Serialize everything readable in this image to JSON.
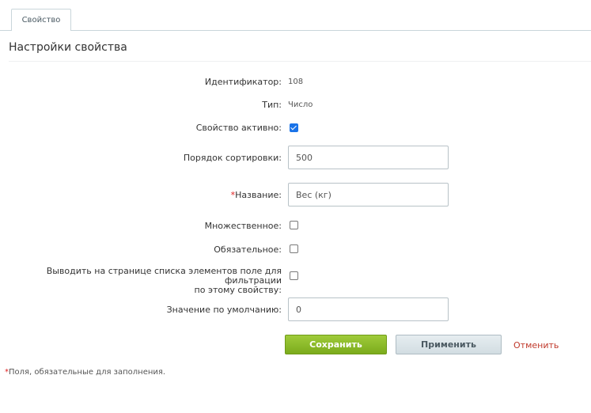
{
  "tabs": [
    {
      "label": "Свойство"
    }
  ],
  "section": {
    "title": "Настройки свойства"
  },
  "fields": {
    "id": {
      "label": "Идентификатор:",
      "value": "108"
    },
    "type": {
      "label": "Тип:",
      "value": "Число"
    },
    "active": {
      "label": "Свойство активно:",
      "checked": true
    },
    "sort": {
      "label": "Порядок сортировки:",
      "value": "500"
    },
    "name": {
      "required_mark": "*",
      "label": "Название:",
      "value": "Вес (кг)"
    },
    "multiple": {
      "label": "Множественное:",
      "checked": false
    },
    "required": {
      "label": "Обязательное:",
      "checked": false
    },
    "filter": {
      "label_line1": "Выводить на странице списка элементов поле для фильтрации",
      "label_line2": "по этому свойству:",
      "checked": false
    },
    "default": {
      "label": "Значение по умолчанию:",
      "value": "0"
    }
  },
  "actions": {
    "save": "Сохранить",
    "apply": "Применить",
    "cancel": "Отменить"
  },
  "footnote": {
    "mark": "*",
    "text": "Поля, обязательные для заполнения."
  },
  "colors": {
    "save": "#8cbc2a",
    "cancel": "#c0392b",
    "required": "#e02020",
    "checkbox": "#1a73e8"
  }
}
